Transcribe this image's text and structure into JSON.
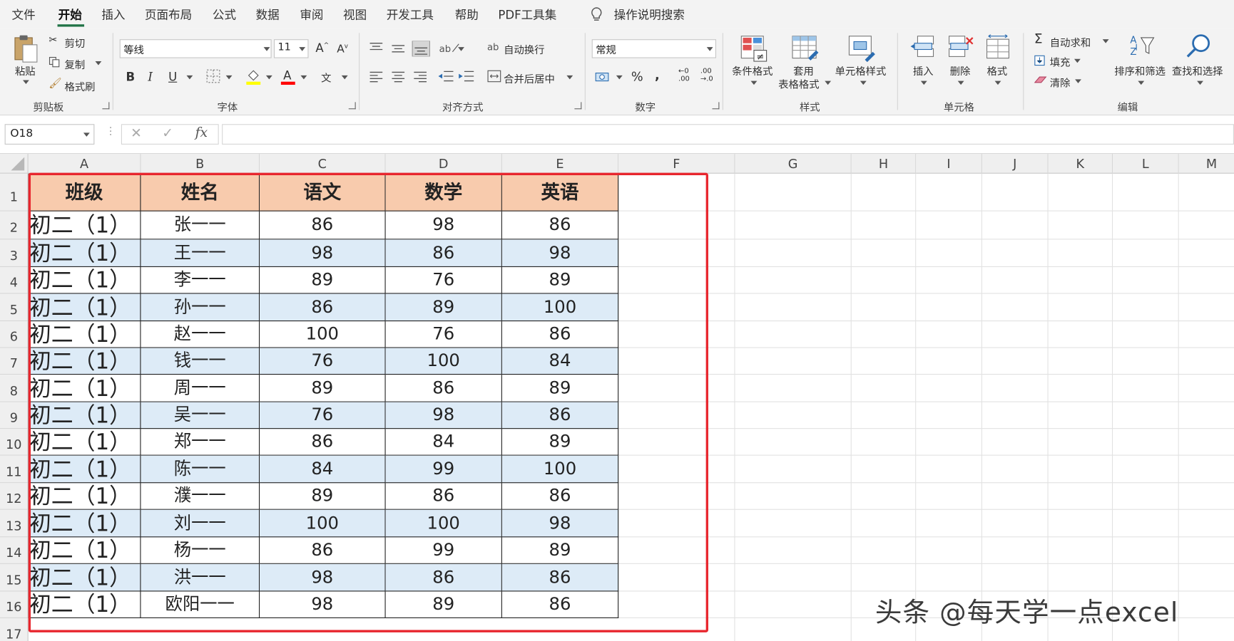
{
  "menu": [
    "文件",
    "开始",
    "插入",
    "页面布局",
    "公式",
    "数据",
    "审阅",
    "视图",
    "开发工具",
    "帮助",
    "PDF工具集"
  ],
  "menu_active": "开始",
  "tell_me": "操作说明搜索",
  "clipboard": {
    "paste": "粘贴",
    "cut": "剪切",
    "copy": "复制",
    "format_painter": "格式刷",
    "label": "剪贴板"
  },
  "font": {
    "name": "等线",
    "size": "11",
    "bold": "B",
    "italic": "I",
    "underline": "U",
    "label": "字体"
  },
  "alignment": {
    "wrap": "自动换行",
    "merge": "合并后居中",
    "label": "对齐方式"
  },
  "number": {
    "format": "常规",
    "percent": "%",
    "comma": ",",
    "label": "数字"
  },
  "styles": {
    "conditional": "条件格式",
    "table_line1": "套用",
    "table_line2": "表格格式",
    "cell_styles": "单元格样式",
    "label": "样式"
  },
  "cells": {
    "insert": "插入",
    "delete": "删除",
    "format": "格式",
    "label": "单元格"
  },
  "editing": {
    "autosum": "自动求和",
    "fill": "填充",
    "clear": "清除",
    "sort": "排序和筛选",
    "find": "查找和选择",
    "label": "编辑"
  },
  "namebox": "O18",
  "fx": "fx",
  "columns": [
    "A",
    "B",
    "C",
    "D",
    "E",
    "F",
    "G",
    "H",
    "I",
    "J",
    "K",
    "L",
    "M"
  ],
  "rows": [
    "1",
    "2",
    "3",
    "4",
    "5",
    "6",
    "7",
    "8",
    "9",
    "10",
    "11",
    "12",
    "13",
    "14",
    "15",
    "16",
    "17"
  ],
  "table": {
    "headers": [
      "班级",
      "姓名",
      "语文",
      "数学",
      "英语"
    ],
    "rows": [
      [
        "初二（1）",
        "张一一",
        "86",
        "98",
        "86"
      ],
      [
        "初二（1）",
        "王一一",
        "98",
        "86",
        "98"
      ],
      [
        "初二（1）",
        "李一一",
        "89",
        "76",
        "89"
      ],
      [
        "初二（1）",
        "孙一一",
        "86",
        "89",
        "100"
      ],
      [
        "初二（1）",
        "赵一一",
        "100",
        "76",
        "86"
      ],
      [
        "初二（1）",
        "钱一一",
        "76",
        "100",
        "84"
      ],
      [
        "初二（1）",
        "周一一",
        "89",
        "86",
        "89"
      ],
      [
        "初二（1）",
        "吴一一",
        "76",
        "98",
        "86"
      ],
      [
        "初二（1）",
        "郑一一",
        "86",
        "84",
        "89"
      ],
      [
        "初二（1）",
        "陈一一",
        "84",
        "99",
        "100"
      ],
      [
        "初二（1）",
        "濮一一",
        "89",
        "86",
        "86"
      ],
      [
        "初二（1）",
        "刘一一",
        "100",
        "100",
        "98"
      ],
      [
        "初二（1）",
        "杨一一",
        "86",
        "99",
        "89"
      ],
      [
        "初二（1）",
        "洪一一",
        "98",
        "86",
        "86"
      ],
      [
        "初二（1）",
        "欧阳一一",
        "98",
        "89",
        "86"
      ]
    ]
  },
  "watermark": "头条 @每天学一点excel",
  "colors": {
    "header_fill": "#f8cbad",
    "band_fill": "#ddebf7",
    "highlight_border": "#e8262e",
    "accent": "#217346"
  }
}
